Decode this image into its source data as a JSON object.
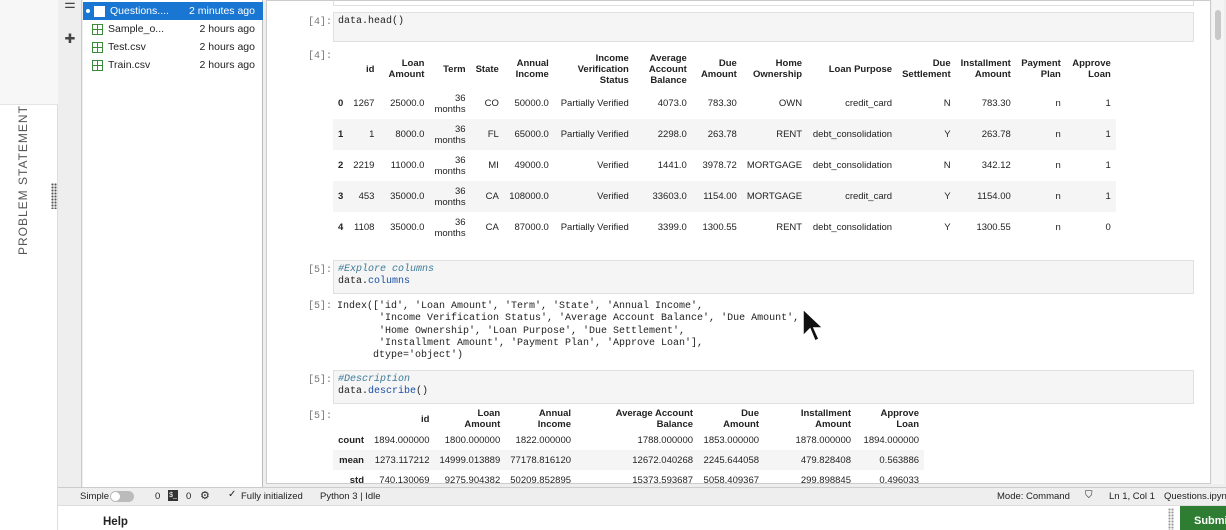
{
  "problem_statement": {
    "label": "PROBLEM STATEMENT"
  },
  "files": [
    {
      "name": "Questions....",
      "modified": "2 minutes ago",
      "type": "notebook",
      "selected": true
    },
    {
      "name": "Sample_o...",
      "modified": "2 hours ago",
      "type": "csv",
      "selected": false
    },
    {
      "name": "Test.csv",
      "modified": "2 hours ago",
      "type": "csv",
      "selected": false
    },
    {
      "name": "Train.csv",
      "modified": "2 hours ago",
      "type": "csv",
      "selected": false
    }
  ],
  "cells": {
    "head": {
      "in_prompt": "[4]:",
      "out_prompt": "[4]:",
      "code": "data.head()"
    },
    "columns": {
      "in_prompt": "[5]:",
      "out_prompt": "[5]:",
      "comment": "#Explore columns",
      "code_obj": "data.",
      "code_attr": "columns"
    },
    "describe": {
      "in_prompt": "[5]:",
      "out_prompt": "[5]:",
      "comment": "#Description",
      "code_obj": "data.",
      "code_fn": "describe",
      "code_tail": "()"
    }
  },
  "head_table": {
    "columns": [
      "",
      "id",
      "Loan Amount",
      "Term",
      "State",
      "Annual Income",
      "Income Verification Status",
      "Average Account Balance",
      "Due Amount",
      "Home Ownership",
      "Loan Purpose",
      "Due Settlement",
      "Installment Amount",
      "Payment Plan",
      "Approve Loan"
    ],
    "rows": [
      [
        "0",
        "1267",
        "25000.0",
        "36 months",
        "CO",
        "50000.0",
        "Partially Verified",
        "4073.0",
        "783.30",
        "OWN",
        "credit_card",
        "N",
        "783.30",
        "n",
        "1"
      ],
      [
        "1",
        "1",
        "8000.0",
        "36 months",
        "FL",
        "65000.0",
        "Partially Verified",
        "2298.0",
        "263.78",
        "RENT",
        "debt_consolidation",
        "Y",
        "263.78",
        "n",
        "1"
      ],
      [
        "2",
        "2219",
        "11000.0",
        "36 months",
        "MI",
        "49000.0",
        "Verified",
        "1441.0",
        "3978.72",
        "MORTGAGE",
        "debt_consolidation",
        "N",
        "342.12",
        "n",
        "1"
      ],
      [
        "3",
        "453",
        "35000.0",
        "36 months",
        "CA",
        "108000.0",
        "Verified",
        "33603.0",
        "1154.00",
        "MORTGAGE",
        "credit_card",
        "Y",
        "1154.00",
        "n",
        "1"
      ],
      [
        "4",
        "1108",
        "35000.0",
        "36 months",
        "CA",
        "87000.0",
        "Partially Verified",
        "3399.0",
        "1300.55",
        "RENT",
        "debt_consolidation",
        "Y",
        "1300.55",
        "n",
        "0"
      ]
    ]
  },
  "columns_output": "Index(['id', 'Loan Amount', 'Term', 'State', 'Annual Income',\n       'Income Verification Status', 'Average Account Balance', 'Due Amount',\n       'Home Ownership', 'Loan Purpose', 'Due Settlement',\n       'Installment Amount', 'Payment Plan', 'Approve Loan'],\n      dtype='object')",
  "describe_table": {
    "columns": [
      "",
      "id",
      "Loan Amount",
      "Annual Income",
      "Average Account Balance",
      "Due Amount",
      "Installment Amount",
      "Approve Loan"
    ],
    "rows": [
      [
        "count",
        "1894.000000",
        "1800.000000",
        "1822.000000",
        "1788.000000",
        "1853.000000",
        "1878.000000",
        "1894.000000"
      ],
      [
        "mean",
        "1273.117212",
        "14999.013889",
        "77178.816120",
        "12672.040268",
        "2245.644058",
        "479.828408",
        "0.563886"
      ],
      [
        "std",
        "740.130069",
        "9275.904382",
        "50209.852895",
        "15373.593687",
        "5058.409367",
        "299.898845",
        "0.496033"
      ]
    ]
  },
  "statusbar": {
    "mode_label": "Simple",
    "terminals": "0",
    "kernels": "0",
    "init": "Fully initialized",
    "kernel": "Python 3 | Idle",
    "mode": "Mode: Command",
    "cursor_pos": "Ln 1, Col 1",
    "file": "Questions.ipyn"
  },
  "bottom": {
    "help": "Help",
    "submit": "Submit"
  }
}
